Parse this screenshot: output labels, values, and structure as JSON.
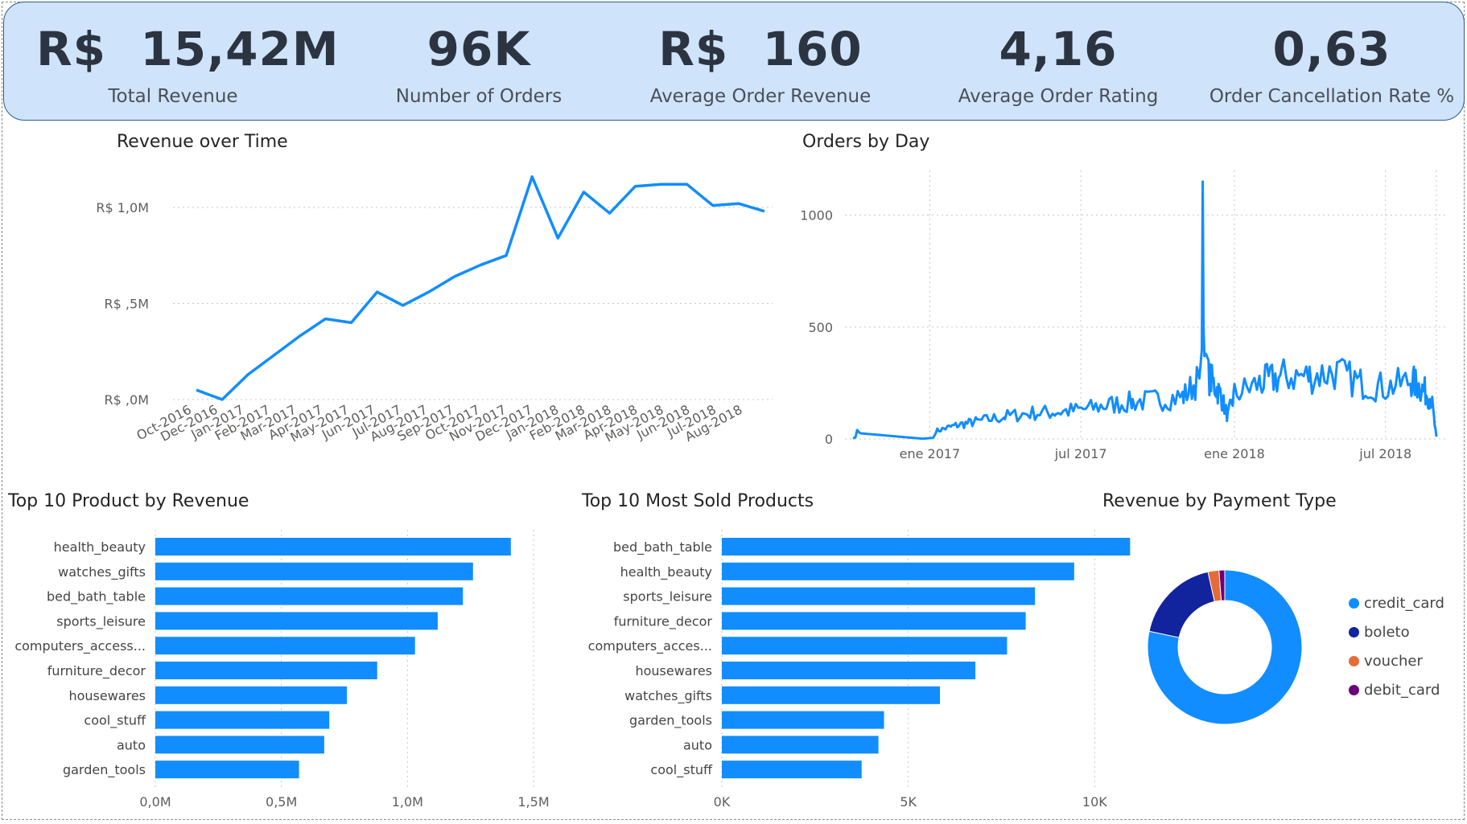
{
  "kpis": [
    {
      "value": "R$  15,42M",
      "label": "Total Revenue"
    },
    {
      "value": "96K",
      "label": "Number of Orders"
    },
    {
      "value": "R$  160",
      "label": "Average Order Revenue"
    },
    {
      "value": "4,16",
      "label": "Average Order Rating"
    },
    {
      "value": "0,63",
      "label": "Order Cancellation Rate %"
    }
  ],
  "colors": {
    "accent": "#118dff",
    "kpi_bg": "#cfe4fb",
    "boleto": "#12239e",
    "voucher": "#e66c37",
    "debit_card": "#6b007b"
  },
  "chart_data": [
    {
      "id": "revenue_over_time",
      "type": "line",
      "title": "Revenue over Time",
      "categories": [
        "Oct-2016",
        "Dec-2016",
        "Jan-2017",
        "Feb-2017",
        "Mar-2017",
        "Apr-2017",
        "May-2017",
        "Jun-2017",
        "Jul-2017",
        "Aug-2017",
        "Sep-2017",
        "Oct-2017",
        "Nov-2017",
        "Dec-2017",
        "Jan-2018",
        "Feb-2018",
        "Mar-2018",
        "Apr-2018",
        "May-2018",
        "Jun-2018",
        "Jul-2018",
        "Aug-2018"
      ],
      "values": [
        0.05,
        0.0,
        0.13,
        0.23,
        0.33,
        0.42,
        0.4,
        0.56,
        0.49,
        0.56,
        0.64,
        0.7,
        0.75,
        1.16,
        0.84,
        1.08,
        0.97,
        1.11,
        1.12,
        1.12,
        1.01,
        1.02,
        0.98
      ],
      "ylim": [
        0,
        1.0
      ],
      "y_ticks": [
        {
          "v": 0,
          "label": "R$ ,0M"
        },
        {
          "v": 0.5,
          "label": "R$ ,5M"
        },
        {
          "v": 1.0,
          "label": "R$ 1,0M"
        }
      ],
      "grid": true
    },
    {
      "id": "orders_by_day",
      "type": "line",
      "title": "Orders by Day",
      "x_range": [
        "2016-10-01",
        "2018-08-31"
      ],
      "ylim": [
        0,
        1200
      ],
      "y_ticks": [
        {
          "v": 0,
          "label": "0"
        },
        {
          "v": 500,
          "label": "500"
        },
        {
          "v": 1000,
          "label": "1000"
        }
      ],
      "x_ticks": [
        {
          "date": "2017-01-01",
          "label": "ene 2017"
        },
        {
          "date": "2017-07-01",
          "label": "jul 2017"
        },
        {
          "date": "2018-01-01",
          "label": "ene 2018"
        },
        {
          "date": "2018-07-01",
          "label": "jul 2018"
        }
      ],
      "points": [
        [
          "2016-10-01",
          2
        ],
        [
          "2016-10-04",
          8
        ],
        [
          "2016-10-06",
          40
        ],
        [
          "2016-10-08",
          30
        ],
        [
          "2016-10-10",
          25
        ],
        [
          "2016-12-23",
          1
        ],
        [
          "2017-01-05",
          5
        ],
        [
          "2017-01-08",
          35
        ],
        [
          "2017-02-01",
          60
        ],
        [
          "2017-03-01",
          80
        ],
        [
          "2017-04-01",
          100
        ],
        [
          "2017-05-01",
          115
        ],
        [
          "2017-06-01",
          120
        ],
        [
          "2017-07-01",
          130
        ],
        [
          "2017-08-01",
          150
        ],
        [
          "2017-09-01",
          165
        ],
        [
          "2017-10-01",
          175
        ],
        [
          "2017-11-01",
          190
        ],
        [
          "2017-11-20",
          270
        ],
        [
          "2017-11-23",
          400
        ],
        [
          "2017-11-24",
          1150
        ],
        [
          "2017-11-25",
          500
        ],
        [
          "2017-11-26",
          370
        ],
        [
          "2017-11-28",
          380
        ],
        [
          "2017-12-01",
          280
        ],
        [
          "2017-12-15",
          200
        ],
        [
          "2017-12-24",
          100
        ],
        [
          "2018-01-01",
          200
        ],
        [
          "2018-02-01",
          250
        ],
        [
          "2018-03-01",
          280
        ],
        [
          "2018-04-01",
          280
        ],
        [
          "2018-05-01",
          300
        ],
        [
          "2018-06-01",
          250
        ],
        [
          "2018-07-01",
          230
        ],
        [
          "2018-08-01",
          260
        ],
        [
          "2018-08-15",
          220
        ],
        [
          "2018-08-25",
          180
        ],
        [
          "2018-08-29",
          60
        ],
        [
          "2018-08-31",
          10
        ]
      ],
      "grid": true
    },
    {
      "id": "top_product_revenue",
      "type": "bar",
      "orientation": "horizontal",
      "title": "Top 10 Product by Revenue",
      "categories": [
        "health_beauty",
        "watches_gifts",
        "bed_bath_table",
        "sports_leisure",
        "computers_access...",
        "furniture_decor",
        "housewares",
        "cool_stuff",
        "auto",
        "garden_tools"
      ],
      "values": [
        1.41,
        1.26,
        1.22,
        1.12,
        1.03,
        0.88,
        0.76,
        0.69,
        0.67,
        0.57
      ],
      "xlim": [
        0,
        1.5
      ],
      "x_ticks": [
        {
          "v": 0,
          "label": "0,0M"
        },
        {
          "v": 0.5,
          "label": "0,5M"
        },
        {
          "v": 1.0,
          "label": "1,0M"
        },
        {
          "v": 1.5,
          "label": "1,5M"
        }
      ]
    },
    {
      "id": "top_most_sold",
      "type": "bar",
      "orientation": "horizontal",
      "title": "Top 10 Most Sold Products",
      "categories": [
        "bed_bath_table",
        "health_beauty",
        "sports_leisure",
        "furniture_decor",
        "computers_acces...",
        "housewares",
        "watches_gifts",
        "garden_tools",
        "auto",
        "cool_stuff"
      ],
      "values": [
        10950,
        9450,
        8400,
        8150,
        7650,
        6800,
        5850,
        4350,
        4200,
        3750
      ],
      "xlim": [
        0,
        12000
      ],
      "x_ticks": [
        {
          "v": 0,
          "label": "0K"
        },
        {
          "v": 5000,
          "label": "5K"
        },
        {
          "v": 10000,
          "label": "10K"
        }
      ]
    },
    {
      "id": "revenue_by_payment",
      "type": "pie",
      "title": "Revenue by Payment Type",
      "labels": [
        "credit_card",
        "boleto",
        "voucher",
        "debit_card"
      ],
      "values": [
        78.3,
        18.2,
        2.3,
        1.2
      ],
      "colors": [
        "#118dff",
        "#12239e",
        "#e66c37",
        "#6b007b"
      ],
      "legend": "right"
    }
  ]
}
